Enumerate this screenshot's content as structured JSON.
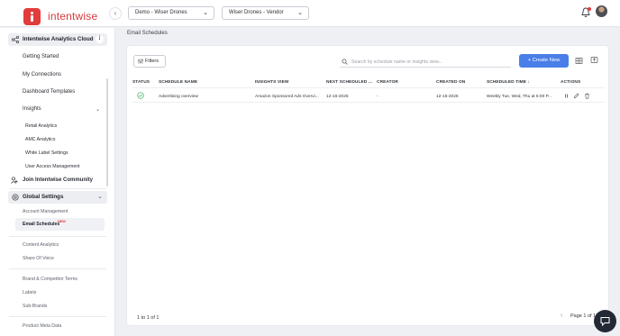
{
  "brand": {
    "name": "intentwise",
    "accent": "#e23b3b",
    "primary": "#4a7ee8"
  },
  "header": {
    "collapse_icon": "chevron-left-icon",
    "account_select": "Demo - Wiser Drones",
    "profile_select": "Wiser Drones - Vendor"
  },
  "sidebar": {
    "analytics_title": "Intentwise Analytics Cloud",
    "items": [
      "Getting Started",
      "My Connections",
      "Dashboard Templates",
      "Insights"
    ],
    "insights_sub": [
      "Retail Analytics",
      "AMC Analytics",
      "White Label Settings",
      "User Access Management"
    ],
    "join": "Join Intentwise Community",
    "global_title": "Global Settings",
    "global_items": [
      "Account Management",
      "Email Schedules",
      "Content Analytics",
      "Share Of Voice",
      "Brand & Competitor Terms",
      "Labels",
      "Sub-Brands",
      "Product Meta Data"
    ],
    "new_badge": "NEW"
  },
  "main": {
    "breadcrumb": "Email Schedules",
    "filters_label": "Filters",
    "search_placeholder": "Search by schedule name or insights view...",
    "create_label": "Create New",
    "columns": [
      "STATUS",
      "SCHEDULE NAME",
      "INSIGHTS VIEW",
      "NEXT SCHEDULED ...",
      "CREATOR",
      "CREATED ON",
      "SCHEDULED TIME",
      "ACTIONS"
    ],
    "rows": [
      {
        "status": "active",
        "schedule_name": "Advertising overview",
        "insights_view": "Amazon Sponsored Ads Overvi...",
        "next_scheduled": "12-16-2025",
        "creator": "-",
        "created_on": "12-15-2025",
        "scheduled_time": "Weekly Tue, Wed, Thu at 5:00 P..."
      }
    ],
    "footer_count": "1 to 1 of 1",
    "page_label": "Page 1 of 1"
  }
}
